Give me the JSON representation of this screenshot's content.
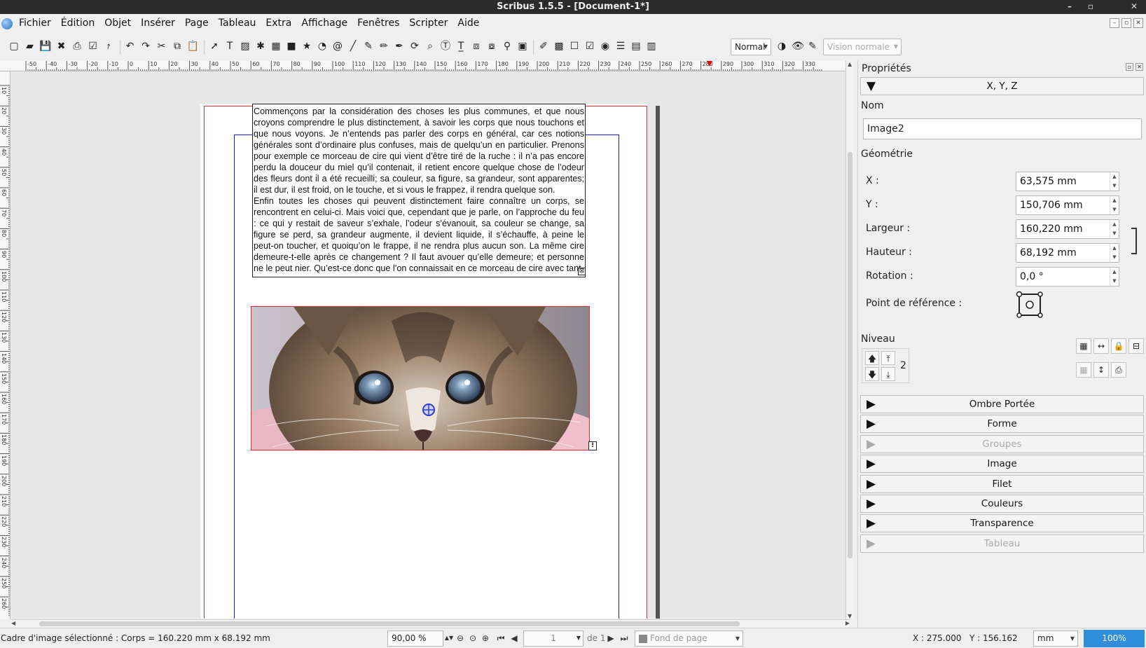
{
  "window": {
    "title": "Scribus 1.5.5 - [Document-1*]",
    "min_glyph": "–",
    "max_glyph": "▫",
    "close_glyph": "✕"
  },
  "menu": [
    "Fichier",
    "Édition",
    "Objet",
    "Insérer",
    "Page",
    "Tableau",
    "Extra",
    "Affichage",
    "Fenêtres",
    "Scripter",
    "Aide"
  ],
  "toolbar": {
    "icons": [
      "new-icon",
      "open-icon",
      "save-icon",
      "close-doc-icon",
      "print-icon",
      "preflight-icon",
      "export-pdf-icon",
      "undo-icon",
      "redo-icon",
      "cut-icon",
      "copy-icon",
      "paste-icon",
      "select-icon",
      "text-frame-icon",
      "image-frame-icon",
      "render-frame-icon",
      "table-icon",
      "shape-icon",
      "polygon-icon",
      "arc-icon",
      "spiral-icon",
      "line-icon",
      "bezier-icon",
      "freehand-icon",
      "calligraphic-icon",
      "rotate-icon",
      "zoom-icon",
      "edit-contents-icon",
      "edit-text-icon",
      "link-frames-icon",
      "unlink-frames-icon",
      "measure-icon",
      "copy-props-icon",
      "eyedropper-icon",
      "pdf-push-button-icon",
      "pdf-text-field-icon",
      "pdf-checkbox-icon",
      "pdf-combo-box-icon",
      "pdf-list-box-icon",
      "pdf-text-annotation-icon",
      "pdf-link-annotation-icon"
    ],
    "glyphs": [
      "▢",
      "▰",
      "💾",
      "✖",
      "⎙",
      "☑",
      "⭎",
      "↶",
      "↷",
      "✂",
      "⧉",
      "📋",
      "➚",
      "T",
      "▨",
      "✱",
      "▦",
      "■",
      "★",
      "◔",
      "@",
      "╱",
      "✎",
      "✏",
      "✒",
      "⟳",
      "⌕",
      "Ⓣ",
      "T̲",
      "⧈",
      "⧇",
      "⚲",
      "▣",
      "✐",
      "▩",
      "☐",
      "☑",
      "◉",
      "☰",
      "▤",
      "▥"
    ],
    "mode_value": "Normal",
    "vision_value": "Vision normale",
    "color_icons": [
      "color-management-icon",
      "preview-eye-icon",
      "edit-mode-icon"
    ]
  },
  "ruler": {
    "h_labels": [
      "-50",
      "-40",
      "-30",
      "-20",
      "-10",
      "0",
      "10",
      "20",
      "30",
      "40",
      "50",
      "60",
      "70",
      "80",
      "90",
      "100",
      "110",
      "120",
      "130",
      "140",
      "150",
      "160",
      "170",
      "180",
      "190",
      "200",
      "210",
      "220",
      "230",
      "240",
      "250",
      "260",
      "270",
      "280",
      "290",
      "300",
      "310",
      "320",
      "330"
    ],
    "v_labels": [
      "10",
      "20",
      "30",
      "40",
      "50",
      "60",
      "70",
      "80",
      "90",
      "100",
      "110",
      "120",
      "130",
      "140",
      "150",
      "160",
      "170",
      "180",
      "190",
      "200",
      "210",
      "220",
      "230",
      "240",
      "250",
      "260"
    ]
  },
  "document": {
    "text_frame": {
      "paragraphs": [
        "Commençons par la considération des choses les plus communes, et que nous croyons comprendre le plus distinctement, à savoir les corps que nous touchons et que nous voyons. Je n’entends pas parler des corps en général, car ces notions générales sont d’ordinaire plus confuses, mais de quelqu’un en particulier. Prenons pour exemple ce morceau de cire qui vient d’être tiré de la ruche : il n’a pas encore perdu la douceur du miel qu’il contenait, il retient encore quelque chose de l’odeur des fleurs dont il a été recueilli; sa couleur, sa figure, sa grandeur, sont apparentes; il est dur, il est froid, on le touche, et si vous le frappez, il rendra quelque son.",
        "Enfin toutes les choses qui peuvent distinctement faire connaître un corps, se rencontrent en celui-ci. Mais voici que, cependant que je parle, on l’approche du feu : ce qui y restait de saveur s’exhale, l’odeur s’évanouit, sa couleur se change, sa figure se perd, sa grandeur augmente, il devient liquide, il s’échauffe, à peine le peut-on toucher, et quoiqu’on le frappe, il ne rendra plus aucun son. La même cire demeure-t-elle après ce changement ? Il faut avouer qu’elle demeure; et personne ne le peut nier. Qu’est-ce donc que l’on connaissait en ce morceau de cire avec tant"
      ],
      "overflow_glyph": "⊠"
    },
    "image_frame": {
      "image_semantic": "kitten-photo",
      "info_glyph": "!"
    }
  },
  "statusbar": {
    "message": "Cadre d'image sélectionné : Corps = 160.220 mm x 68.192 mm",
    "zoom_value": "90,00 %",
    "page_value": "1",
    "page_of": "de 1",
    "layer_value": "Fond de page",
    "coord_x": "X : 275.000",
    "coord_y": "Y : 156.162",
    "unit_value": "mm",
    "zoom_button": "100%"
  },
  "properties": {
    "panel_title": "Propriétés",
    "xyz_section": "X, Y, Z",
    "name_label": "Nom",
    "name_value": "Image2",
    "geometry_label": "Géométrie",
    "x_label": "X :",
    "x_value": "63,575 mm",
    "y_label": "Y :",
    "y_value": "150,706 mm",
    "width_label": "Largeur :",
    "width_value": "160,220 mm",
    "height_label": "Hauteur :",
    "height_value": "68,192 mm",
    "rotation_label": "Rotation :",
    "rotation_value": "0,0 °",
    "ref_point_label": "Point de référence :",
    "level_label": "Niveau",
    "level_value": "2",
    "sections": [
      {
        "label": "Ombre Portée",
        "enabled": true
      },
      {
        "label": "Forme",
        "enabled": true
      },
      {
        "label": "Groupes",
        "enabled": false
      },
      {
        "label": "Image",
        "enabled": true
      },
      {
        "label": "Filet",
        "enabled": true
      },
      {
        "label": "Couleurs",
        "enabled": true
      },
      {
        "label": "Transparence",
        "enabled": true
      },
      {
        "label": "Tableau",
        "enabled": false
      }
    ]
  },
  "colors": {
    "bleed": "#e03030",
    "margins": "#1c1ccd",
    "accent": "#2f8fdc"
  }
}
